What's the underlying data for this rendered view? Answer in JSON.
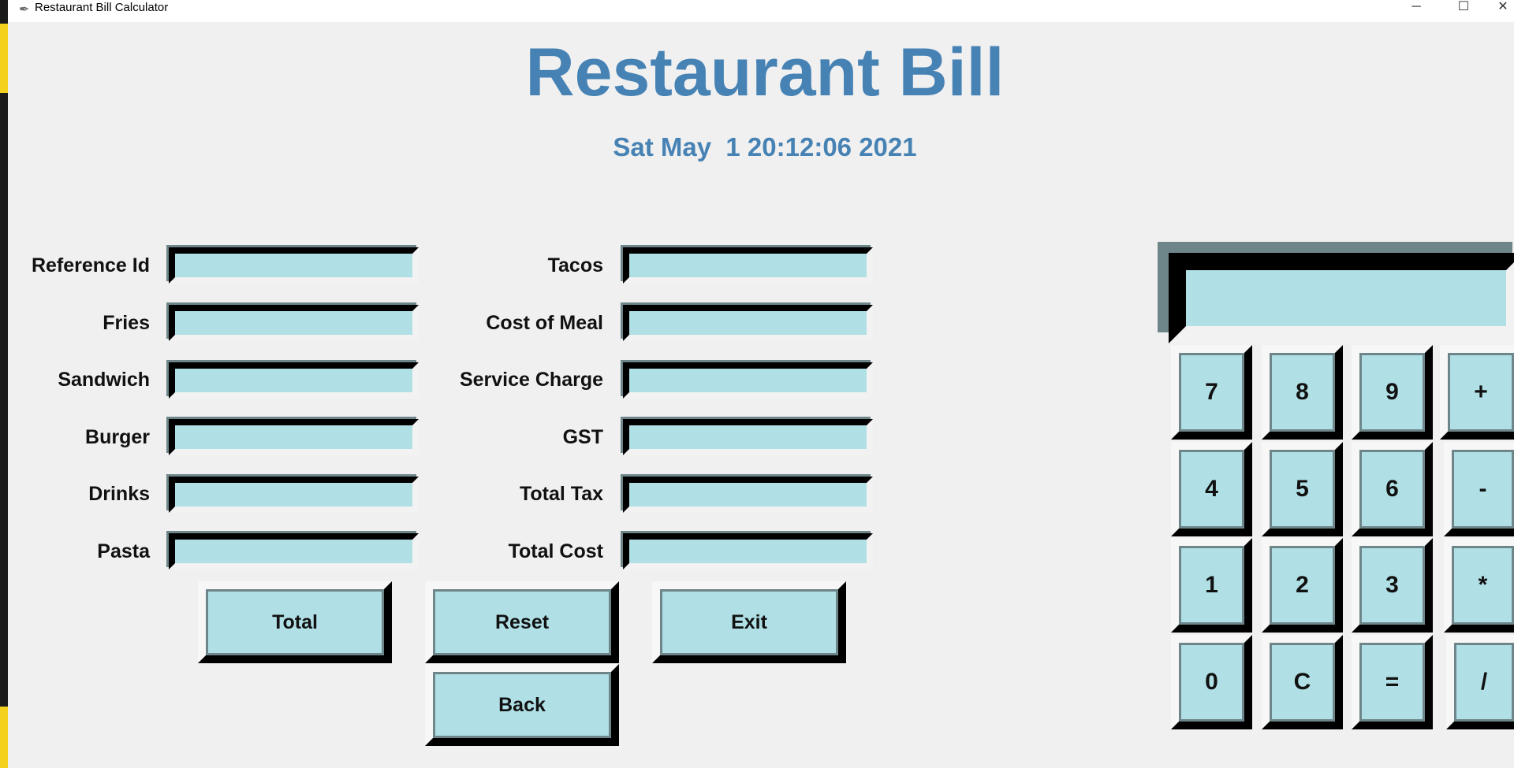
{
  "window": {
    "title": "Restaurant Bill Calculator",
    "minimize": "─",
    "maximize": "☐",
    "close": "✕"
  },
  "header": {
    "title": "Restaurant Bill",
    "datetime": "Sat May  1 20:12:06 2021"
  },
  "items": [
    {
      "label": "Reference Id",
      "value": ""
    },
    {
      "label": "Fries",
      "value": ""
    },
    {
      "label": "Sandwich",
      "value": ""
    },
    {
      "label": "Burger",
      "value": ""
    },
    {
      "label": "Drinks",
      "value": ""
    },
    {
      "label": "Pasta",
      "value": ""
    }
  ],
  "costs": [
    {
      "label": "Tacos",
      "value": ""
    },
    {
      "label": "Cost of Meal",
      "value": ""
    },
    {
      "label": "Service Charge",
      "value": ""
    },
    {
      "label": "GST",
      "value": ""
    },
    {
      "label": "Total Tax",
      "value": ""
    },
    {
      "label": "Total Cost",
      "value": ""
    }
  ],
  "actions": {
    "total": "Total",
    "reset": "Reset",
    "exit": "Exit",
    "back": "Back"
  },
  "calculator": {
    "display": "",
    "keys": [
      [
        "7",
        "8",
        "9",
        "+"
      ],
      [
        "4",
        "5",
        "6",
        "-"
      ],
      [
        "1",
        "2",
        "3",
        "*"
      ],
      [
        "0",
        "C",
        "=",
        "/"
      ]
    ]
  },
  "colors": {
    "accent": "#4682b4",
    "field": "#b0e0e6",
    "background": "#f0f0f0"
  }
}
